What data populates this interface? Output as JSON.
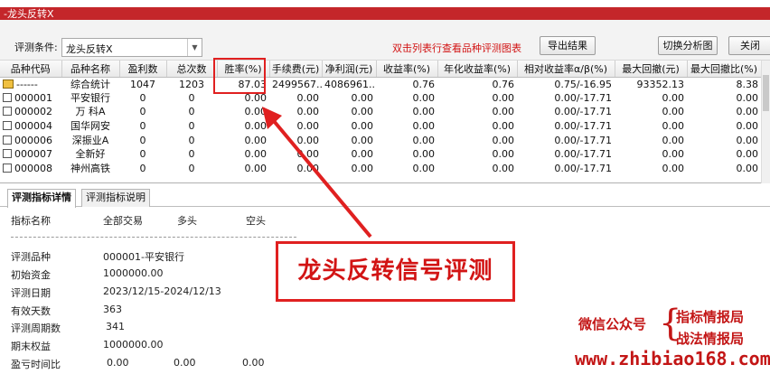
{
  "window": {
    "title": "-龙头反转X"
  },
  "toolbar": {
    "condition_label": "评测条件:",
    "condition_value": "龙头反转X",
    "hint": "双击列表行查看品种评测图表",
    "export_label": "导出结果",
    "switch_label": "切换分析图",
    "close_label": "关闭"
  },
  "table": {
    "headers": [
      "品种代码",
      "品种名称",
      "盈利数",
      "总次数",
      "胜率(%)",
      "手续费(元)",
      "净利润(元)",
      "收益率(%)",
      "年化收益率(%)",
      "相对收益率α/β(%)",
      "最大回撤(元)",
      "最大回撤比(%)"
    ],
    "rows": [
      {
        "code": "------",
        "name": "综合统计",
        "win": "1047",
        "total": "1203",
        "rate": "87.03",
        "fee": "2499567....",
        "profit": "4086961...",
        "ret": "0.76",
        "annual": "0.76",
        "rel": "0.75/-16.95",
        "dd": "93352.13",
        "ddr": "8.38"
      },
      {
        "code": "000001",
        "name": "平安银行",
        "win": "0",
        "total": "0",
        "rate": "0.00",
        "fee": "0.00",
        "profit": "0.00",
        "ret": "0.00",
        "annual": "0.00",
        "rel": "0.00/-17.71",
        "dd": "0.00",
        "ddr": "0.00"
      },
      {
        "code": "000002",
        "name": "万 科A",
        "win": "0",
        "total": "0",
        "rate": "0.00",
        "fee": "0.00",
        "profit": "0.00",
        "ret": "0.00",
        "annual": "0.00",
        "rel": "0.00/-17.71",
        "dd": "0.00",
        "ddr": "0.00"
      },
      {
        "code": "000004",
        "name": "国华网安",
        "win": "0",
        "total": "0",
        "rate": "0.00",
        "fee": "0.00",
        "profit": "0.00",
        "ret": "0.00",
        "annual": "0.00",
        "rel": "0.00/-17.71",
        "dd": "0.00",
        "ddr": "0.00"
      },
      {
        "code": "000006",
        "name": "深振业A",
        "win": "0",
        "total": "0",
        "rate": "0.00",
        "fee": "0.00",
        "profit": "0.00",
        "ret": "0.00",
        "annual": "0.00",
        "rel": "0.00/-17.71",
        "dd": "0.00",
        "ddr": "0.00"
      },
      {
        "code": "000007",
        "name": "全新好",
        "win": "0",
        "total": "0",
        "rate": "0.00",
        "fee": "0.00",
        "profit": "0.00",
        "ret": "0.00",
        "annual": "0.00",
        "rel": "0.00/-17.71",
        "dd": "0.00",
        "ddr": "0.00"
      },
      {
        "code": "000008",
        "name": "神州高铁",
        "win": "0",
        "total": "0",
        "rate": "0.00",
        "fee": "0.00",
        "profit": "0.00",
        "ret": "0.00",
        "annual": "0.00",
        "rel": "0.00/-17.71",
        "dd": "0.00",
        "ddr": "0.00"
      }
    ]
  },
  "tabs": {
    "detail": "评测指标详情",
    "explain": "评测指标说明"
  },
  "detail": {
    "col_name": "指标名称",
    "col_all": "全部交易",
    "col_long": "多头",
    "col_short": "空头",
    "rows": [
      {
        "label": "评测品种",
        "value": "000001-平安银行"
      },
      {
        "label": "初始资金",
        "value": "1000000.00"
      },
      {
        "label": "评测日期",
        "value": "2023/12/15-2024/12/13"
      },
      {
        "label": "有效天数",
        "value": "363"
      },
      {
        "label": "评测周期数",
        "value": "341"
      },
      {
        "label": "期末权益",
        "value": "1000000.00"
      },
      {
        "label": "盈亏时间比",
        "value": "0.00",
        "long": "0.00",
        "short": "0.00"
      }
    ]
  },
  "annotation": {
    "callout": "龙头反转信号评测",
    "arrow_color": "#e02020"
  },
  "watermark": {
    "wechat": "微信公众号",
    "line1": "指标情报局",
    "line2": "战法情报局",
    "url": "www.zhibiao168.com"
  }
}
